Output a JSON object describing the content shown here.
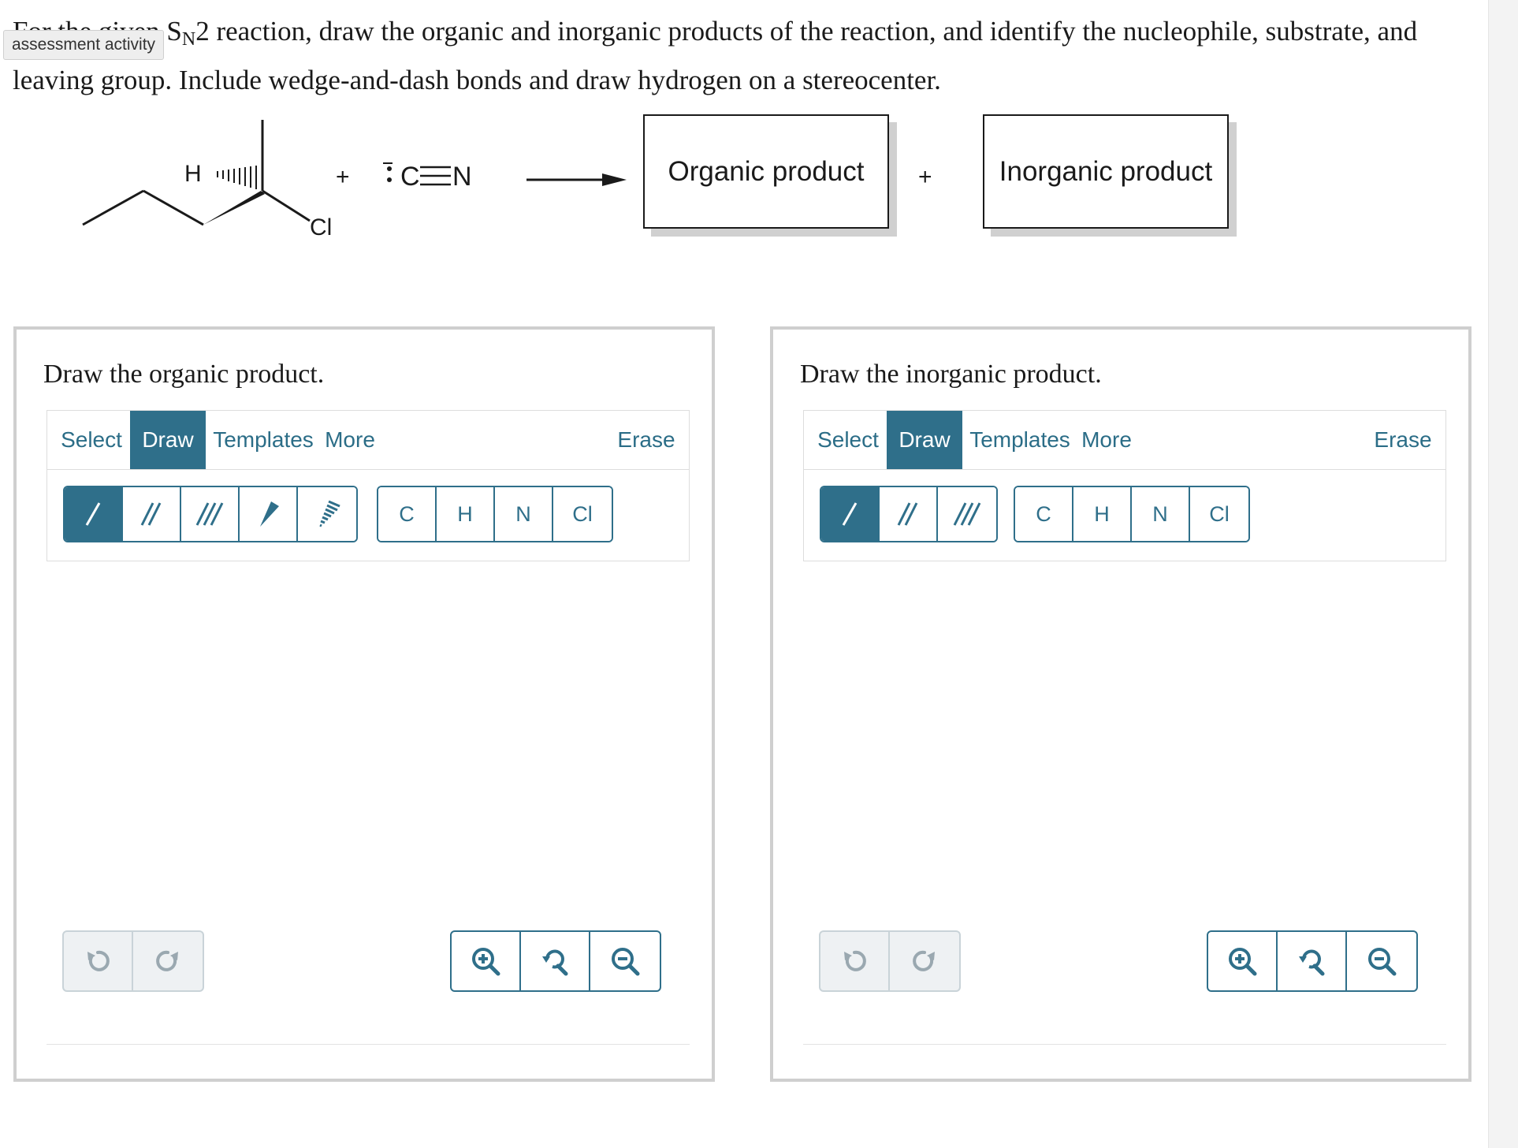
{
  "question": {
    "text_before": "For the given S",
    "subscript": "N",
    "text_after": "2 reaction, draw the organic and inorganic products of the reaction, and identify the nucleophile, substrate, and leaving group. Include wedge-and-dash bonds and draw hydrogen on a stereocenter."
  },
  "badge": "assessment activity",
  "reaction": {
    "h_label": "H",
    "cl_label": "Cl",
    "plus": "+",
    "nucleophile_c": "C",
    "nucleophile_n": "N",
    "organic_product_label": "Organic product",
    "inorganic_product_label": "Inorganic product"
  },
  "panels": [
    {
      "title": "Draw the organic product.",
      "tabs": {
        "select": "Select",
        "draw": "Draw",
        "templates": "Templates",
        "more": "More",
        "erase": "Erase"
      },
      "atoms": [
        "C",
        "H",
        "N",
        "Cl"
      ]
    },
    {
      "title": "Draw the inorganic product.",
      "tabs": {
        "select": "Select",
        "draw": "Draw",
        "templates": "Templates",
        "more": "More",
        "erase": "Erase"
      },
      "atoms": [
        "C",
        "H",
        "N",
        "Cl"
      ]
    }
  ],
  "colors": {
    "accent": "#2f6f8a",
    "border": "#cfcfcf",
    "text": "#1a1a1a"
  }
}
